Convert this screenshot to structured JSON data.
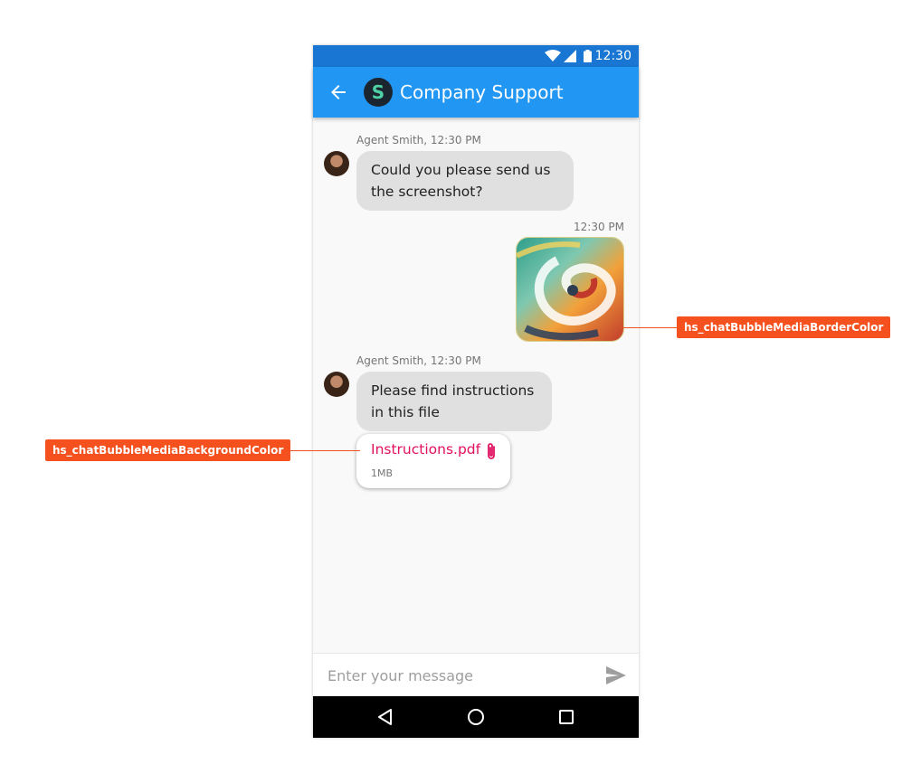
{
  "status_bar": {
    "time": "12:30"
  },
  "app_bar": {
    "title": "Company Support",
    "logo_letter": "S"
  },
  "messages": [
    {
      "meta": "Agent Smith, 12:30 PM",
      "text": "Could you please send us the screenshot?"
    },
    {
      "meta": "12:30 PM",
      "type": "image"
    },
    {
      "meta": "Agent Smith, 12:30 PM",
      "text": "Please find instructions in this file"
    }
  ],
  "attachment": {
    "name": "Instructions.pdf",
    "size": "1MB"
  },
  "composer": {
    "placeholder": "Enter your message"
  },
  "annotations": {
    "media_border": "hs_chatBubbleMediaBorderColor",
    "media_background": "hs_chatBubbleMediaBackgroundColor"
  },
  "colors": {
    "status_bar": "#1976d2",
    "app_bar": "#2196f3",
    "bubble": "#e0e0e0",
    "attachment_text": "#e0115f",
    "annotation": "#f4511e"
  },
  "icons": [
    "back-arrow-icon",
    "wifi-icon",
    "cell-signal-icon",
    "battery-icon",
    "paperclip-icon",
    "send-icon",
    "nav-back-icon",
    "nav-home-icon",
    "nav-recents-icon"
  ]
}
